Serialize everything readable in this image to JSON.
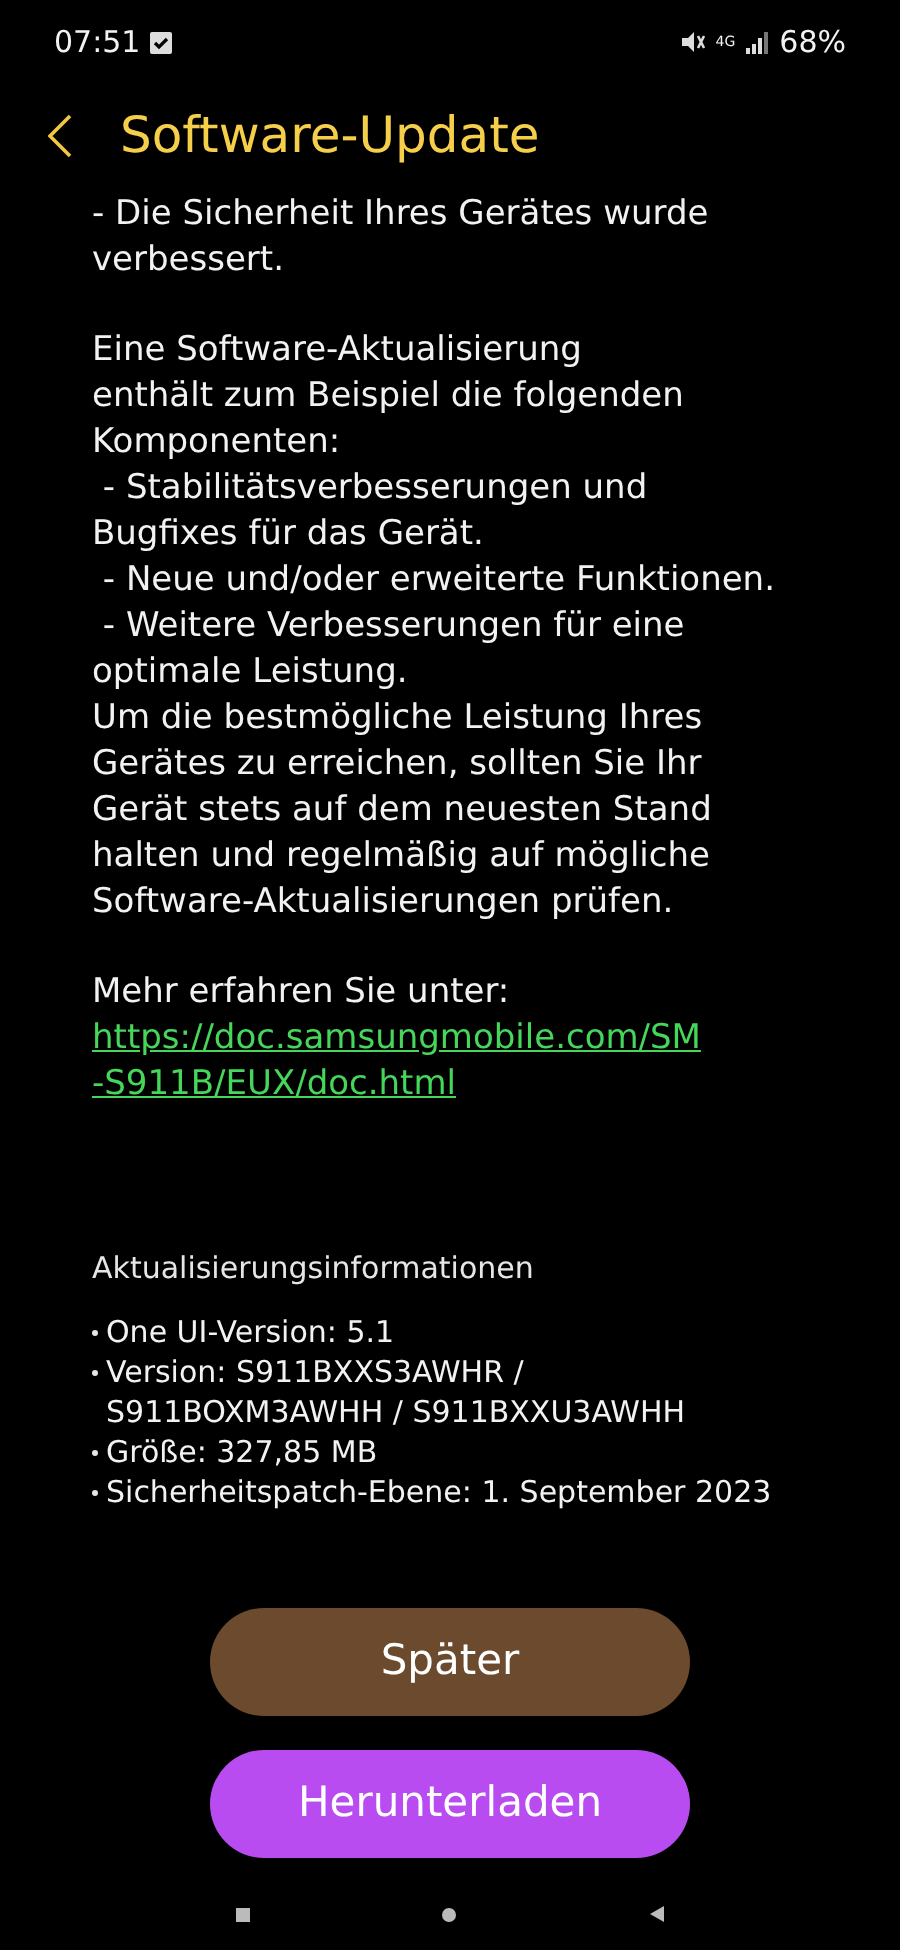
{
  "status_bar": {
    "time": "07:51",
    "battery": "68%",
    "network": "4G"
  },
  "header": {
    "title": "Software-Update"
  },
  "paragraphs": [
    {
      "lines": [
        "- Die Sicherheit Ihres Gerätes wurde",
        "verbessert."
      ]
    },
    {
      "lines": [
        "Eine Software-Aktualisierung",
        "enthält zum Beispiel die folgenden",
        "Komponenten:",
        " - Stabilitätsverbesserungen und",
        "Bugfixes für das Gerät.",
        " - Neue und/oder erweiterte Funktionen.",
        " - Weitere Verbesserungen für eine",
        "optimale Leistung.",
        "Um die bestmögliche Leistung Ihres",
        "Gerätes zu erreichen, sollten Sie Ihr",
        "Gerät stets auf dem neuesten Stand",
        "halten und regelmäßig auf mögliche",
        "Software-Aktualisierungen prüfen."
      ]
    },
    {
      "lines": [
        "Mehr erfahren Sie unter:"
      ],
      "link_lines": [
        "https://doc.samsungmobile.com/SM",
        "-S911B/EUX/doc.html"
      ]
    }
  ],
  "info": {
    "heading": "Aktualisierungsinformationen",
    "items": [
      {
        "lines": [
          "One UI-Version: 5.1"
        ]
      },
      {
        "lines": [
          "Version: S911BXXS3AWHR /",
          "S911BOXM3AWHH / S911BXXU3AWHH"
        ]
      },
      {
        "lines": [
          "Größe: 327,85 MB"
        ]
      },
      {
        "lines": [
          "Sicherheitspatch-Ebene: 1. September 2023"
        ]
      }
    ]
  },
  "buttons": [
    {
      "label": "Später",
      "kind": "secondary"
    },
    {
      "label": "Herunterladen",
      "kind": "primary"
    }
  ]
}
